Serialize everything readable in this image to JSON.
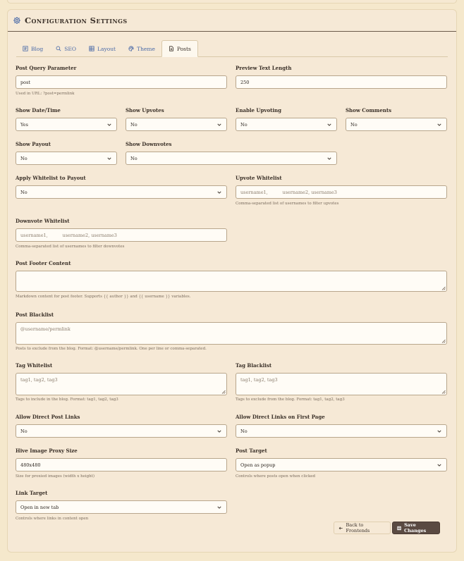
{
  "header": {
    "title": "Configuration Settings",
    "icon": "gear-icon"
  },
  "tabs": [
    {
      "label": "Blog",
      "icon": "blog-icon",
      "active": false
    },
    {
      "label": "SEO",
      "icon": "search-icon",
      "active": false
    },
    {
      "label": "Layout",
      "icon": "layout-grid-icon",
      "active": false
    },
    {
      "label": "Theme",
      "icon": "palette-icon",
      "active": false
    },
    {
      "label": "Posts",
      "icon": "document-icon",
      "active": true
    }
  ],
  "fields": {
    "post_query_param": {
      "label": "Post Query Parameter",
      "value": "post",
      "help": "Used in URL: ?post=permlink"
    },
    "preview_text_length": {
      "label": "Preview Text Length",
      "value": "250"
    },
    "show_date_time": {
      "label": "Show Date/Time",
      "value": "Yes"
    },
    "show_upvotes": {
      "label": "Show Upvotes",
      "value": "No"
    },
    "enable_upvoting": {
      "label": "Enable Upvoting",
      "value": "No"
    },
    "show_comments": {
      "label": "Show Comments",
      "value": "No"
    },
    "show_payout": {
      "label": "Show Payout",
      "value": "No"
    },
    "show_downvotes": {
      "label": "Show Downvotes",
      "value": "No"
    },
    "apply_whitelist_payout": {
      "label": "Apply Whitelist to Payout",
      "value": "No"
    },
    "upvote_whitelist": {
      "label": "Upvote Whitelist",
      "placeholder": "username1,          username2, username3",
      "help": "Comma-separated list of usernames to filter upvotes"
    },
    "downvote_whitelist": {
      "label": "Downvote Whitelist",
      "placeholder": "username1,          username2, username3",
      "help": "Comma-separated list of usernames to filter downvotes"
    },
    "post_footer": {
      "label": "Post Footer Content",
      "placeholder": "",
      "help": "Markdown content for post footer. Supports {{ author }} and {{ username }} variables."
    },
    "post_blacklist": {
      "label": "Post Blacklist",
      "placeholder": "@username/permlink",
      "help": "Posts to exclude from the blog. Format: @username/permlink. One per line or comma-separated."
    },
    "tag_whitelist": {
      "label": "Tag Whitelist",
      "placeholder": "tag1, tag2, tag3",
      "help": "Tags to include in the blog. Format: tag1, tag2, tag3"
    },
    "tag_blacklist": {
      "label": "Tag Blacklist",
      "placeholder": "tag1, tag2, tag3",
      "help": "Tags to exclude from the blog. Format: tag1, tag2, tag3"
    },
    "allow_direct_links": {
      "label": "Allow Direct Post Links",
      "value": "No"
    },
    "allow_direct_first_page": {
      "label": "Allow Direct Links on First Page",
      "value": "No"
    },
    "hive_image_proxy": {
      "label": "Hive Image Proxy Size",
      "value": "480x480",
      "help": "Size for proxied images (width x height)"
    },
    "post_target": {
      "label": "Post Target",
      "value": "Open as popup",
      "help": "Controls where posts open when clicked"
    },
    "link_target": {
      "label": "Link Target",
      "value": "Open in new tab",
      "help": "Controls where links in content open"
    }
  },
  "actions": {
    "back_label": "Back to Frontends",
    "save_label": "Save Changes"
  }
}
